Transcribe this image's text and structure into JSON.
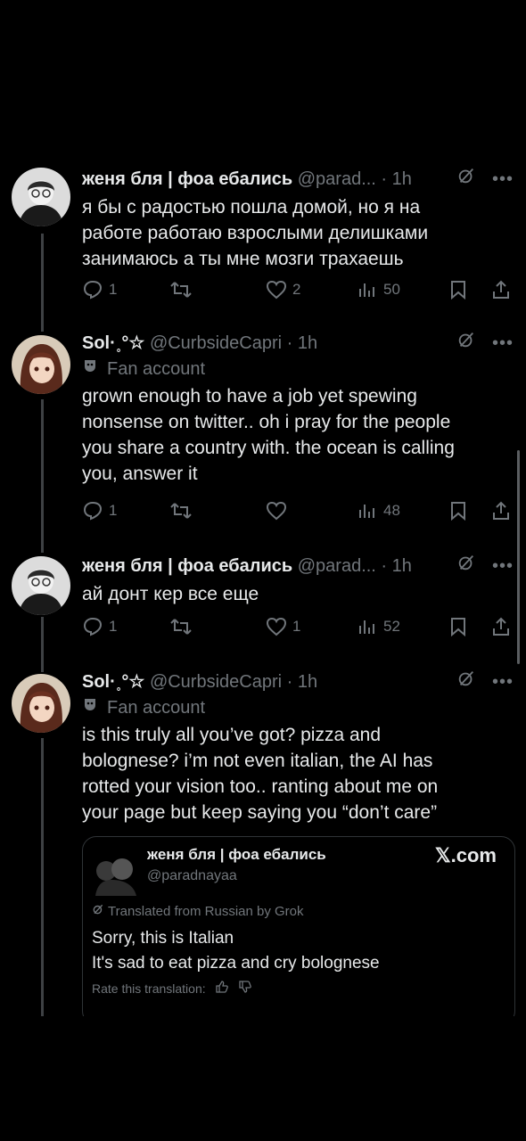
{
  "tweets": [
    {
      "name": "женя бля | фоа ебались",
      "handle": "@parad...",
      "time": "· 1h",
      "text": [
        "я бы с радостью пошла домой, но я на",
        "работе работаю взрослыми делишками",
        "занимаюсь а ты мне мозги трахаешь"
      ],
      "replies": "1",
      "retweets": "",
      "likes": "2",
      "views": "50",
      "avatar_icon": "user-avatar-photo"
    },
    {
      "name": "Sol·˳°☆",
      "handle": "@CurbsideCapri",
      "time": "· 1h",
      "fan_label": "Fan account",
      "text": [
        "grown enough to have a job yet spewing",
        "nonsense on twitter.. oh i pray for the people",
        "you share a country with. the ocean is calling",
        "you, answer it"
      ],
      "replies": "1",
      "retweets": "",
      "likes": "",
      "views": "48",
      "avatar_icon": "anime-avatar"
    },
    {
      "name": "женя бля | фоа ебались",
      "handle": "@parad...",
      "time": "· 1h",
      "text": [
        "ай донт кер все еще"
      ],
      "replies": "1",
      "retweets": "",
      "likes": "1",
      "views": "52",
      "avatar_icon": "user-avatar-photo"
    },
    {
      "name": "Sol·˳°☆",
      "handle": "@CurbsideCapri",
      "time": "· 1h",
      "fan_label": "Fan account",
      "text": [
        "is this truly all you’ve got? pizza and",
        "bolognese? i’m not even italian, the AI has",
        "rotted your vision too.. ranting about me on",
        "your page but keep saying you “don’t care”"
      ],
      "avatar_icon": "anime-avatar"
    }
  ],
  "quote": {
    "name": "женя бля | фоа ебались",
    "handle": "@paradnayaa",
    "x_logo": "𝕏.com",
    "translated_label": "Translated from Russian by Grok",
    "text": [
      "Sorry, this is Italian",
      "It's sad to eat pizza and cry bolognese"
    ],
    "rate_label": "Rate this translation:"
  },
  "colors": {
    "background": "#000000",
    "text": "#e7e9ea",
    "muted": "#71767b",
    "thread_line": "#3e4144"
  }
}
